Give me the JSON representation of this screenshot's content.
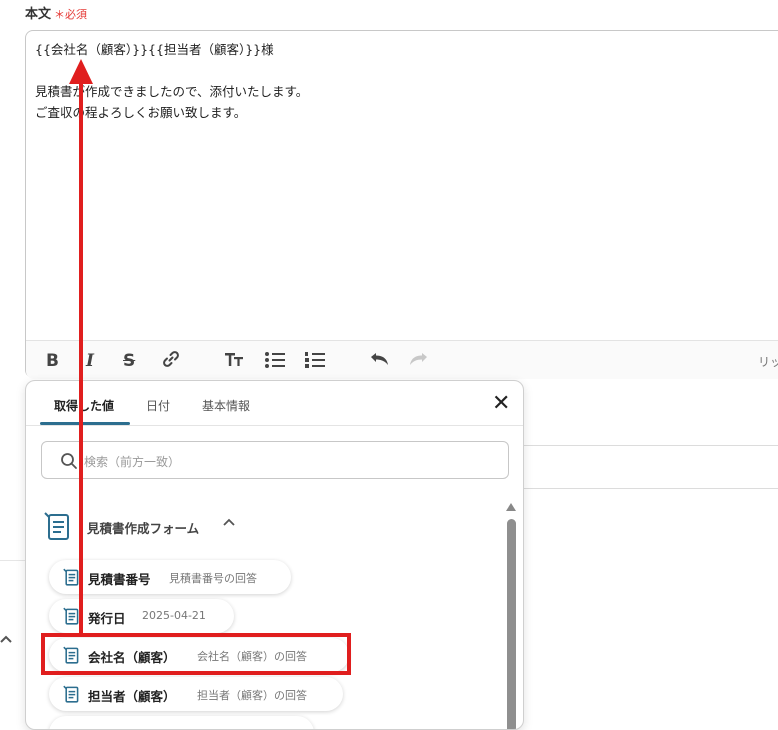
{
  "field": {
    "label": "本文",
    "required_mark": "＊",
    "required_text": "必須"
  },
  "editor": {
    "lines": [
      "{{会社名（顧客）}}{{担当者（顧客）}}様",
      "",
      "見積書が作成できましたので、添付いたします。",
      "ご査収の程よろしくお願い致します。"
    ],
    "toolbar": {
      "bold": "B",
      "italic": "I",
      "strike": "S",
      "right_text": "リッ"
    }
  },
  "panel": {
    "tabs": [
      "取得した値",
      "日付",
      "基本情報"
    ],
    "active_tab": 0,
    "close": "✕",
    "search_placeholder": "検索（前方一致）",
    "group_title": "見積書作成フォーム",
    "group_chevron": "^",
    "items": [
      {
        "name": "見積書番号",
        "desc": "見積書番号の回答"
      },
      {
        "name": "発行日",
        "desc": "2025-04-21"
      },
      {
        "name": "会社名（顧客）",
        "desc": "会社名（顧客）の回答"
      },
      {
        "name": "担当者（顧客）",
        "desc": "担当者（顧客）の回答"
      }
    ]
  },
  "colors": {
    "accent": "#2c6e8f",
    "annotation_red": "#e01e1e",
    "required_red": "#e53935"
  }
}
